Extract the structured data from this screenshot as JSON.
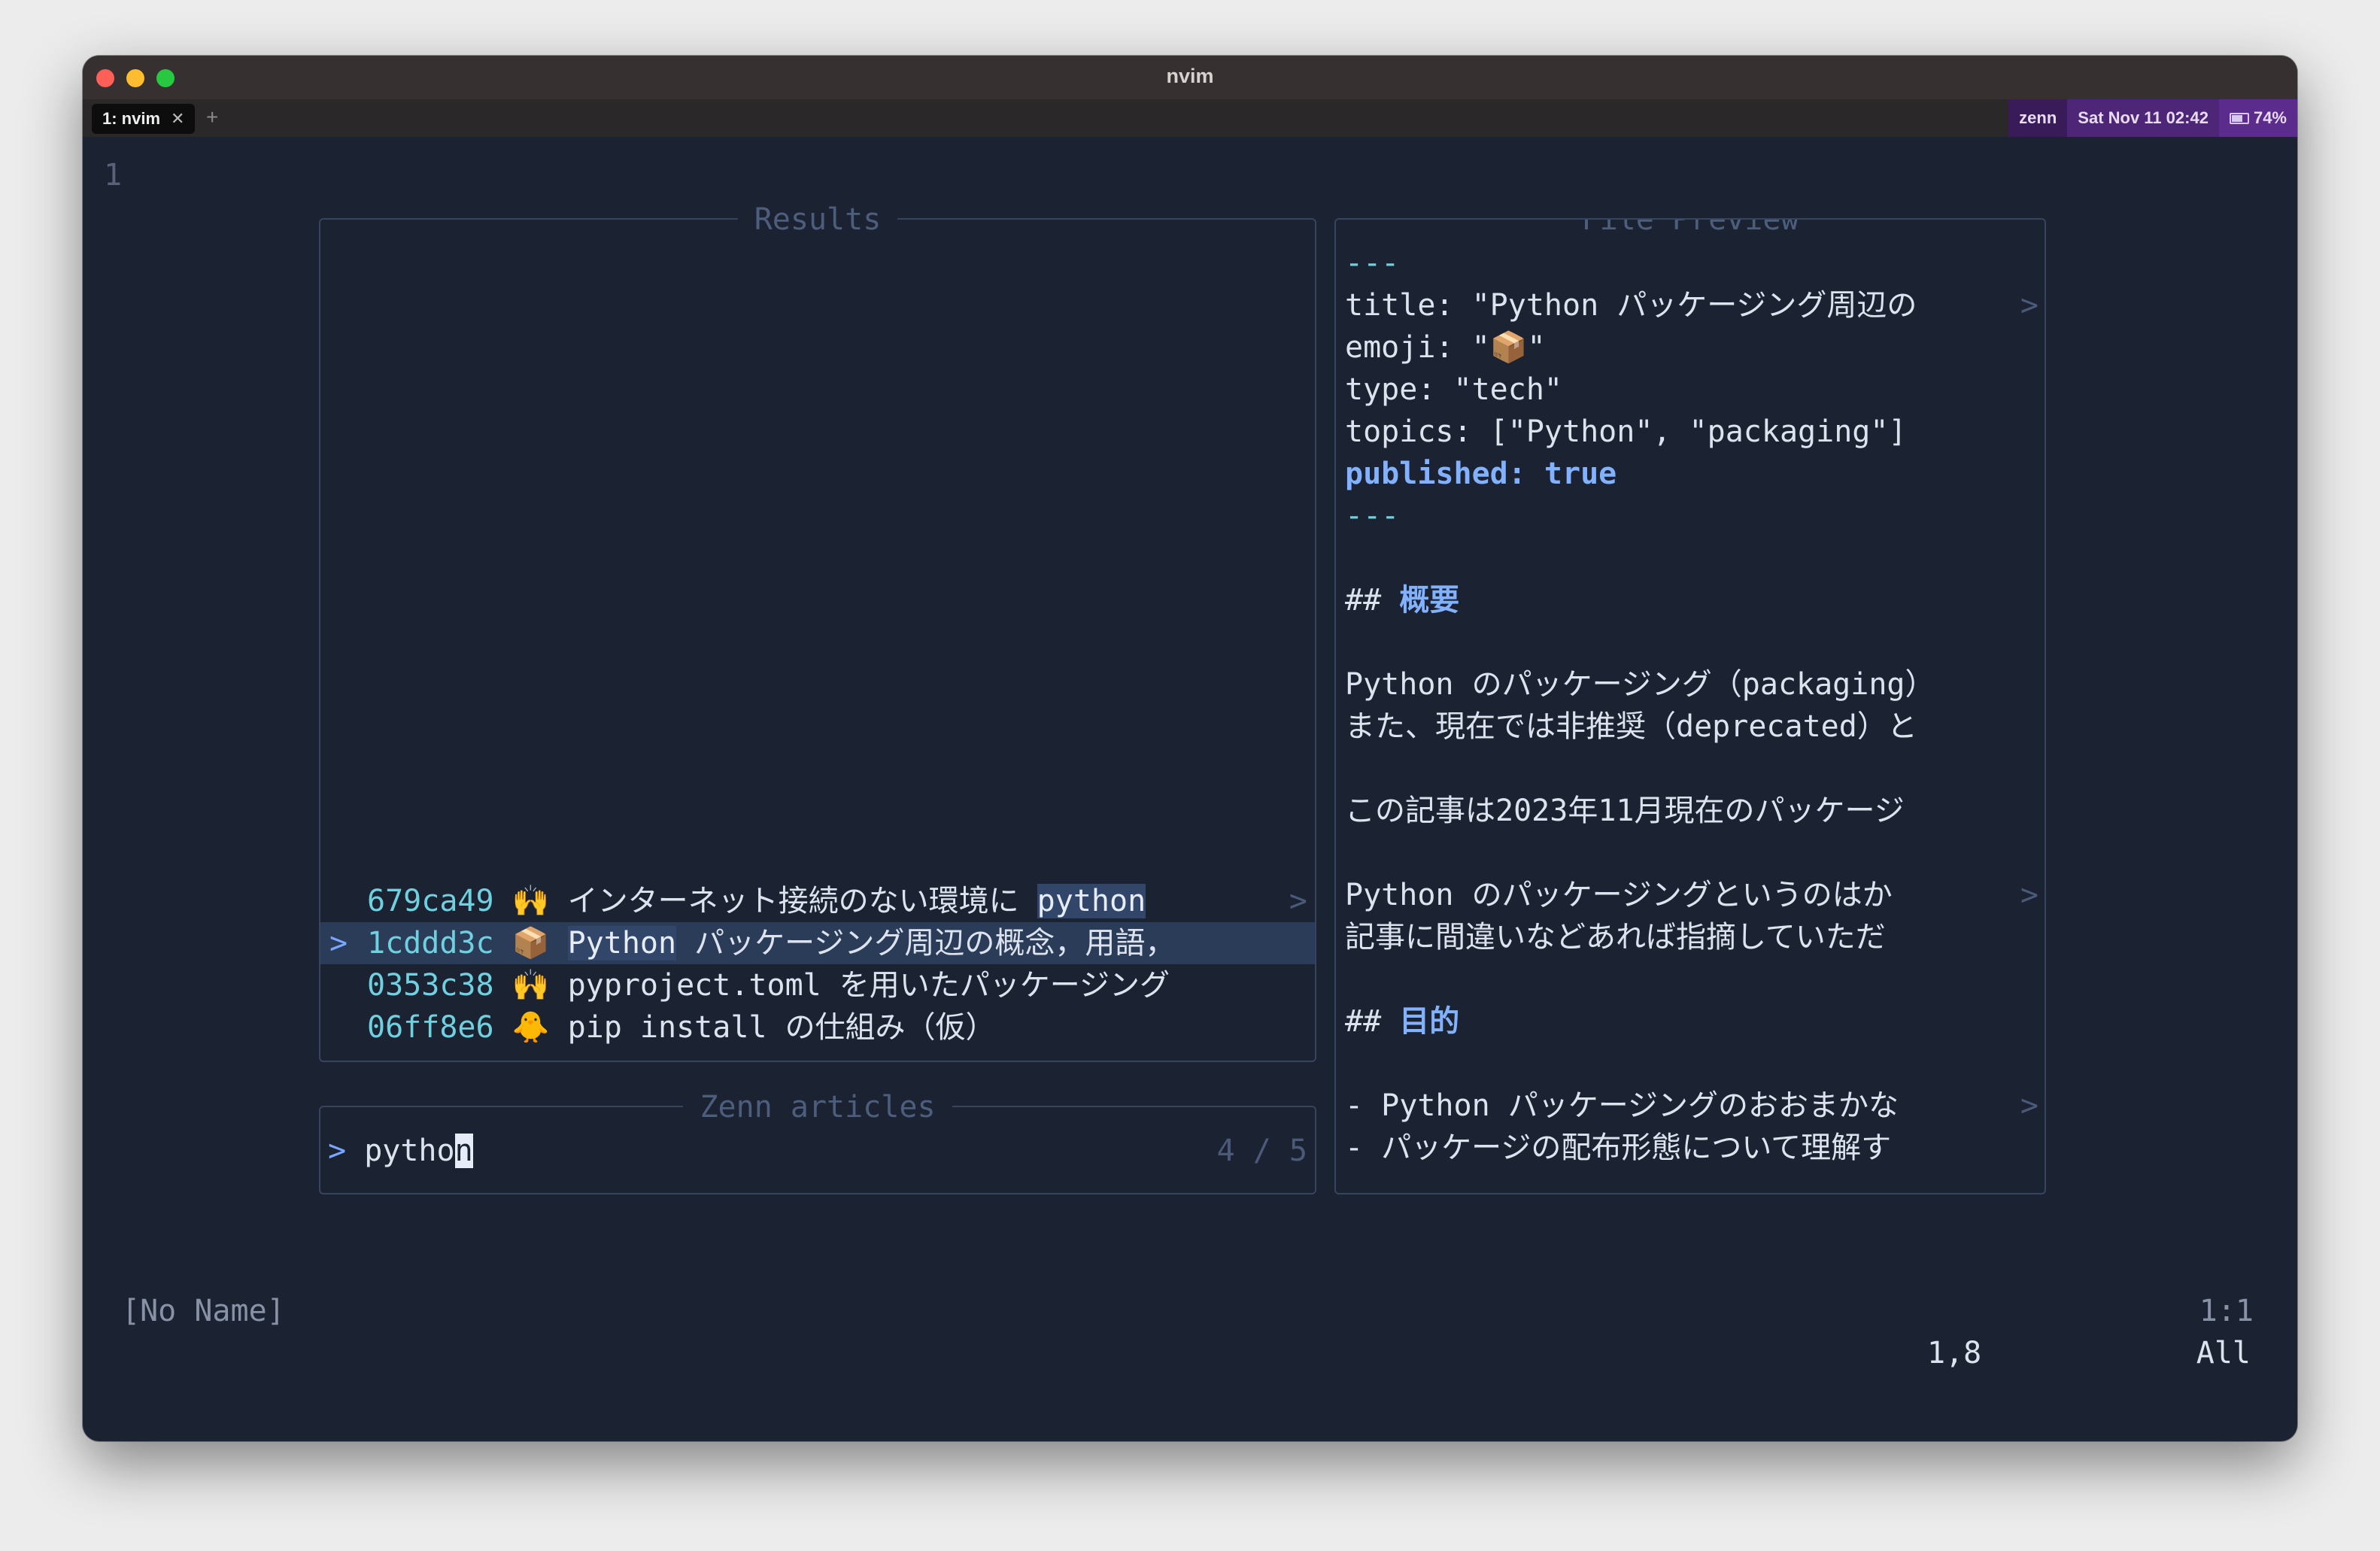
{
  "window": {
    "title": "nvim"
  },
  "tabbar": {
    "active_tab": "1: nvim",
    "close_glyph": "✕",
    "new_tab_glyph": "+",
    "status_session": "zenn",
    "status_datetime": "Sat Nov 11 02:42",
    "battery": "74%"
  },
  "editor": {
    "line_number": "1"
  },
  "results": {
    "title": "Results",
    "rows": [
      {
        "hash": "679ca49",
        "emoji": "🙌",
        "pre": "インターネット接続のない環境に ",
        "match": "python",
        "post": " ",
        "truncated": true,
        "selected": false
      },
      {
        "hash": "1cddd3c",
        "emoji": "📦",
        "pre": "",
        "match": "Python",
        "post": " パッケージング周辺の概念，用語，",
        "truncated": false,
        "selected": true
      },
      {
        "hash": "0353c38",
        "emoji": "🙌",
        "pre": "pyproject.toml を用いたパッケージング",
        "match": "",
        "post": "",
        "truncated": false,
        "selected": false
      },
      {
        "hash": "06ff8e6",
        "emoji": "🐥",
        "pre": "pip install の仕組み（仮）",
        "match": "",
        "post": "",
        "truncated": false,
        "selected": false
      }
    ],
    "selection_marker": ">",
    "truncation_marker": ">"
  },
  "search": {
    "title": "Zenn articles",
    "prompt": ">",
    "query_before_cursor": "pytho",
    "query_cursor_char": "n",
    "counter": "4 / 5"
  },
  "preview": {
    "title": "File Preview",
    "lines": [
      {
        "kind": "fm",
        "text": "---"
      },
      {
        "kind": "text",
        "text": "title: \"Python パッケージング周辺の",
        "truncated": true
      },
      {
        "kind": "text",
        "text": "emoji: \"📦\""
      },
      {
        "kind": "text",
        "text": "type: \"tech\""
      },
      {
        "kind": "text",
        "text": "topics: [\"Python\", \"packaging\"]"
      },
      {
        "kind": "pub",
        "text": "published: true"
      },
      {
        "kind": "fm",
        "text": "---"
      },
      {
        "kind": "blank",
        "text": ""
      },
      {
        "kind": "heading",
        "prefix": "## ",
        "text": "概要"
      },
      {
        "kind": "blank",
        "text": ""
      },
      {
        "kind": "text",
        "text": "Python のパッケージング（packaging）"
      },
      {
        "kind": "text",
        "text": "また、現在では非推奨（deprecated）と"
      },
      {
        "kind": "blank",
        "text": ""
      },
      {
        "kind": "text",
        "text": "この記事は2023年11月現在のパッケージ"
      },
      {
        "kind": "blank",
        "text": ""
      },
      {
        "kind": "text",
        "text": "Python のパッケージングというのはか",
        "truncated": true
      },
      {
        "kind": "text",
        "text": "記事に間違いなどあれば指摘していただ"
      },
      {
        "kind": "blank",
        "text": ""
      },
      {
        "kind": "heading",
        "prefix": "## ",
        "text": "目的"
      },
      {
        "kind": "blank",
        "text": ""
      },
      {
        "kind": "text",
        "text": "- Python パッケージングのおおまかな",
        "truncated": true
      },
      {
        "kind": "text",
        "text": "- パッケージの配布形態について理解す"
      }
    ],
    "truncation_marker": ">"
  },
  "statusline": {
    "buffer_name": "[No Name]",
    "position_top": "1:1",
    "ruler": "1,8",
    "scroll": "All"
  }
}
